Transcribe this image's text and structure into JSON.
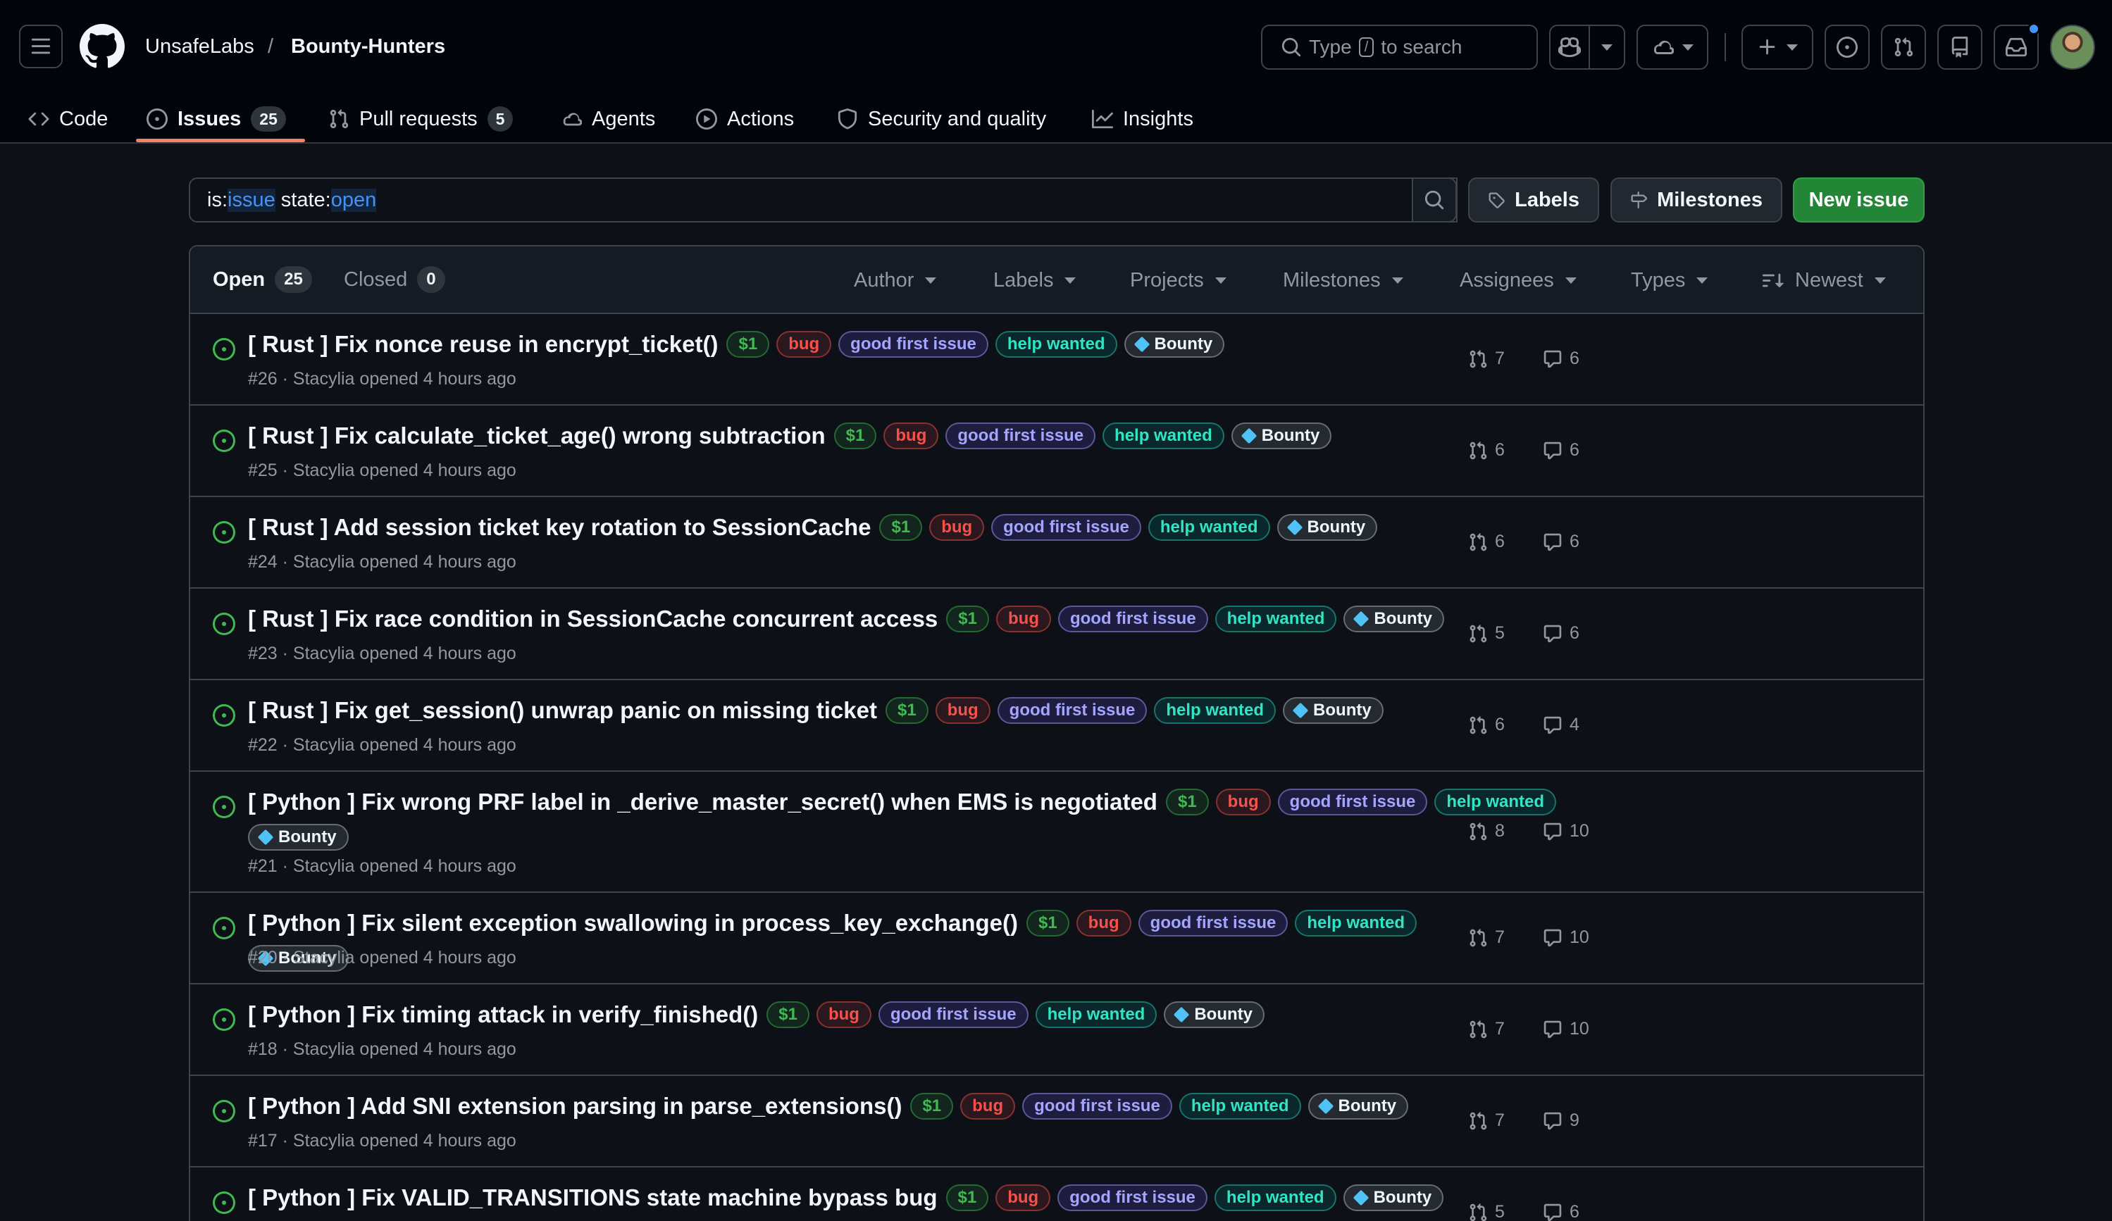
{
  "header": {
    "owner": "UnsafeLabs",
    "separator": "/",
    "repo": "Bounty-Hunters",
    "search_prefix": "Type",
    "search_key": "/",
    "search_suffix": "to search"
  },
  "tabs": [
    {
      "label": "Code",
      "icon": "code-icon"
    },
    {
      "label": "Issues",
      "count": "25",
      "icon": "issue-opened-icon",
      "active": true
    },
    {
      "label": "Pull requests",
      "count": "5",
      "icon": "git-pull-request-icon"
    },
    {
      "label": "Agents",
      "icon": "agent-icon"
    },
    {
      "label": "Actions",
      "icon": "play-icon"
    },
    {
      "label": "Security and quality",
      "icon": "shield-icon"
    },
    {
      "label": "Insights",
      "icon": "graph-icon"
    }
  ],
  "filter": {
    "k1": "is:",
    "v1": "issue",
    "k2": " state:",
    "v2": "open"
  },
  "buttons": {
    "labels": "Labels",
    "milestones": "Milestones",
    "new_issue": "New issue"
  },
  "states": {
    "open_label": "Open",
    "open_count": "25",
    "closed_label": "Closed",
    "closed_count": "0"
  },
  "filters": [
    "Author",
    "Labels",
    "Projects",
    "Milestones",
    "Assignees",
    "Types",
    "Newest"
  ],
  "colors": {
    "price": "#3fb950",
    "bug": "#f85149",
    "good_first_issue": "#a5a5ff",
    "help_wanted": "#2ee6c4",
    "open_icon": "#3fb950",
    "new_issue_button": "#238636"
  },
  "issues": [
    {
      "title": "[ Rust ] Fix nonce reuse in encrypt_ticket()",
      "labels": [
        "$1",
        "bug",
        "good first issue",
        "help wanted",
        "Bounty"
      ],
      "meta": "#26 · Stacylia opened 4 hours ago",
      "prs": "7",
      "comments": "6"
    },
    {
      "title": "[ Rust ] Fix calculate_ticket_age() wrong subtraction",
      "labels": [
        "$1",
        "bug",
        "good first issue",
        "help wanted",
        "Bounty"
      ],
      "meta": "#25 · Stacylia opened 4 hours ago",
      "prs": "6",
      "comments": "6"
    },
    {
      "title": "[ Rust ] Add session ticket key rotation to SessionCache",
      "labels": [
        "$1",
        "bug",
        "good first issue",
        "help wanted",
        "Bounty"
      ],
      "meta": "#24 · Stacylia opened 4 hours ago",
      "prs": "6",
      "comments": "6"
    },
    {
      "title": "[ Rust ] Fix race condition in SessionCache concurrent access",
      "labels": [
        "$1",
        "bug",
        "good first issue",
        "help wanted",
        "Bounty"
      ],
      "meta": "#23 · Stacylia opened 4 hours ago",
      "prs": "5",
      "comments": "6"
    },
    {
      "title": "[ Rust ] Fix get_session() unwrap panic on missing ticket",
      "labels": [
        "$1",
        "bug",
        "good first issue",
        "help wanted",
        "Bounty"
      ],
      "meta": "#22 · Stacylia opened 4 hours ago",
      "prs": "6",
      "comments": "4"
    },
    {
      "title": "[ Python ] Fix wrong PRF label in _derive_master_secret() when EMS is negotiated",
      "labels": [
        "$1",
        "bug",
        "good first issue",
        "help wanted",
        "Bounty"
      ],
      "meta": "#21 · Stacylia opened 4 hours ago",
      "prs": "8",
      "comments": "10"
    },
    {
      "title": "[ Python ] Fix silent exception swallowing in process_key_exchange()",
      "labels": [
        "$1",
        "bug",
        "good first issue",
        "help wanted",
        "Bounty"
      ],
      "meta": "#20 · Stacylia opened 4 hours ago",
      "prs": "7",
      "comments": "10"
    },
    {
      "title": "[ Python ] Fix timing attack in verify_finished()",
      "labels": [
        "$1",
        "bug",
        "good first issue",
        "help wanted",
        "Bounty"
      ],
      "meta": "#18 · Stacylia opened 4 hours ago",
      "prs": "7",
      "comments": "10"
    },
    {
      "title": "[ Python ] Add SNI extension parsing in parse_extensions()",
      "labels": [
        "$1",
        "bug",
        "good first issue",
        "help wanted",
        "Bounty"
      ],
      "meta": "#17 · Stacylia opened 4 hours ago",
      "prs": "7",
      "comments": "9"
    },
    {
      "title": "[ Python ] Fix VALID_TRANSITIONS state machine bypass bug",
      "labels": [
        "$1",
        "bug",
        "good first issue",
        "help wanted",
        "Bounty"
      ],
      "meta": "",
      "prs": "5",
      "comments": "6"
    }
  ]
}
